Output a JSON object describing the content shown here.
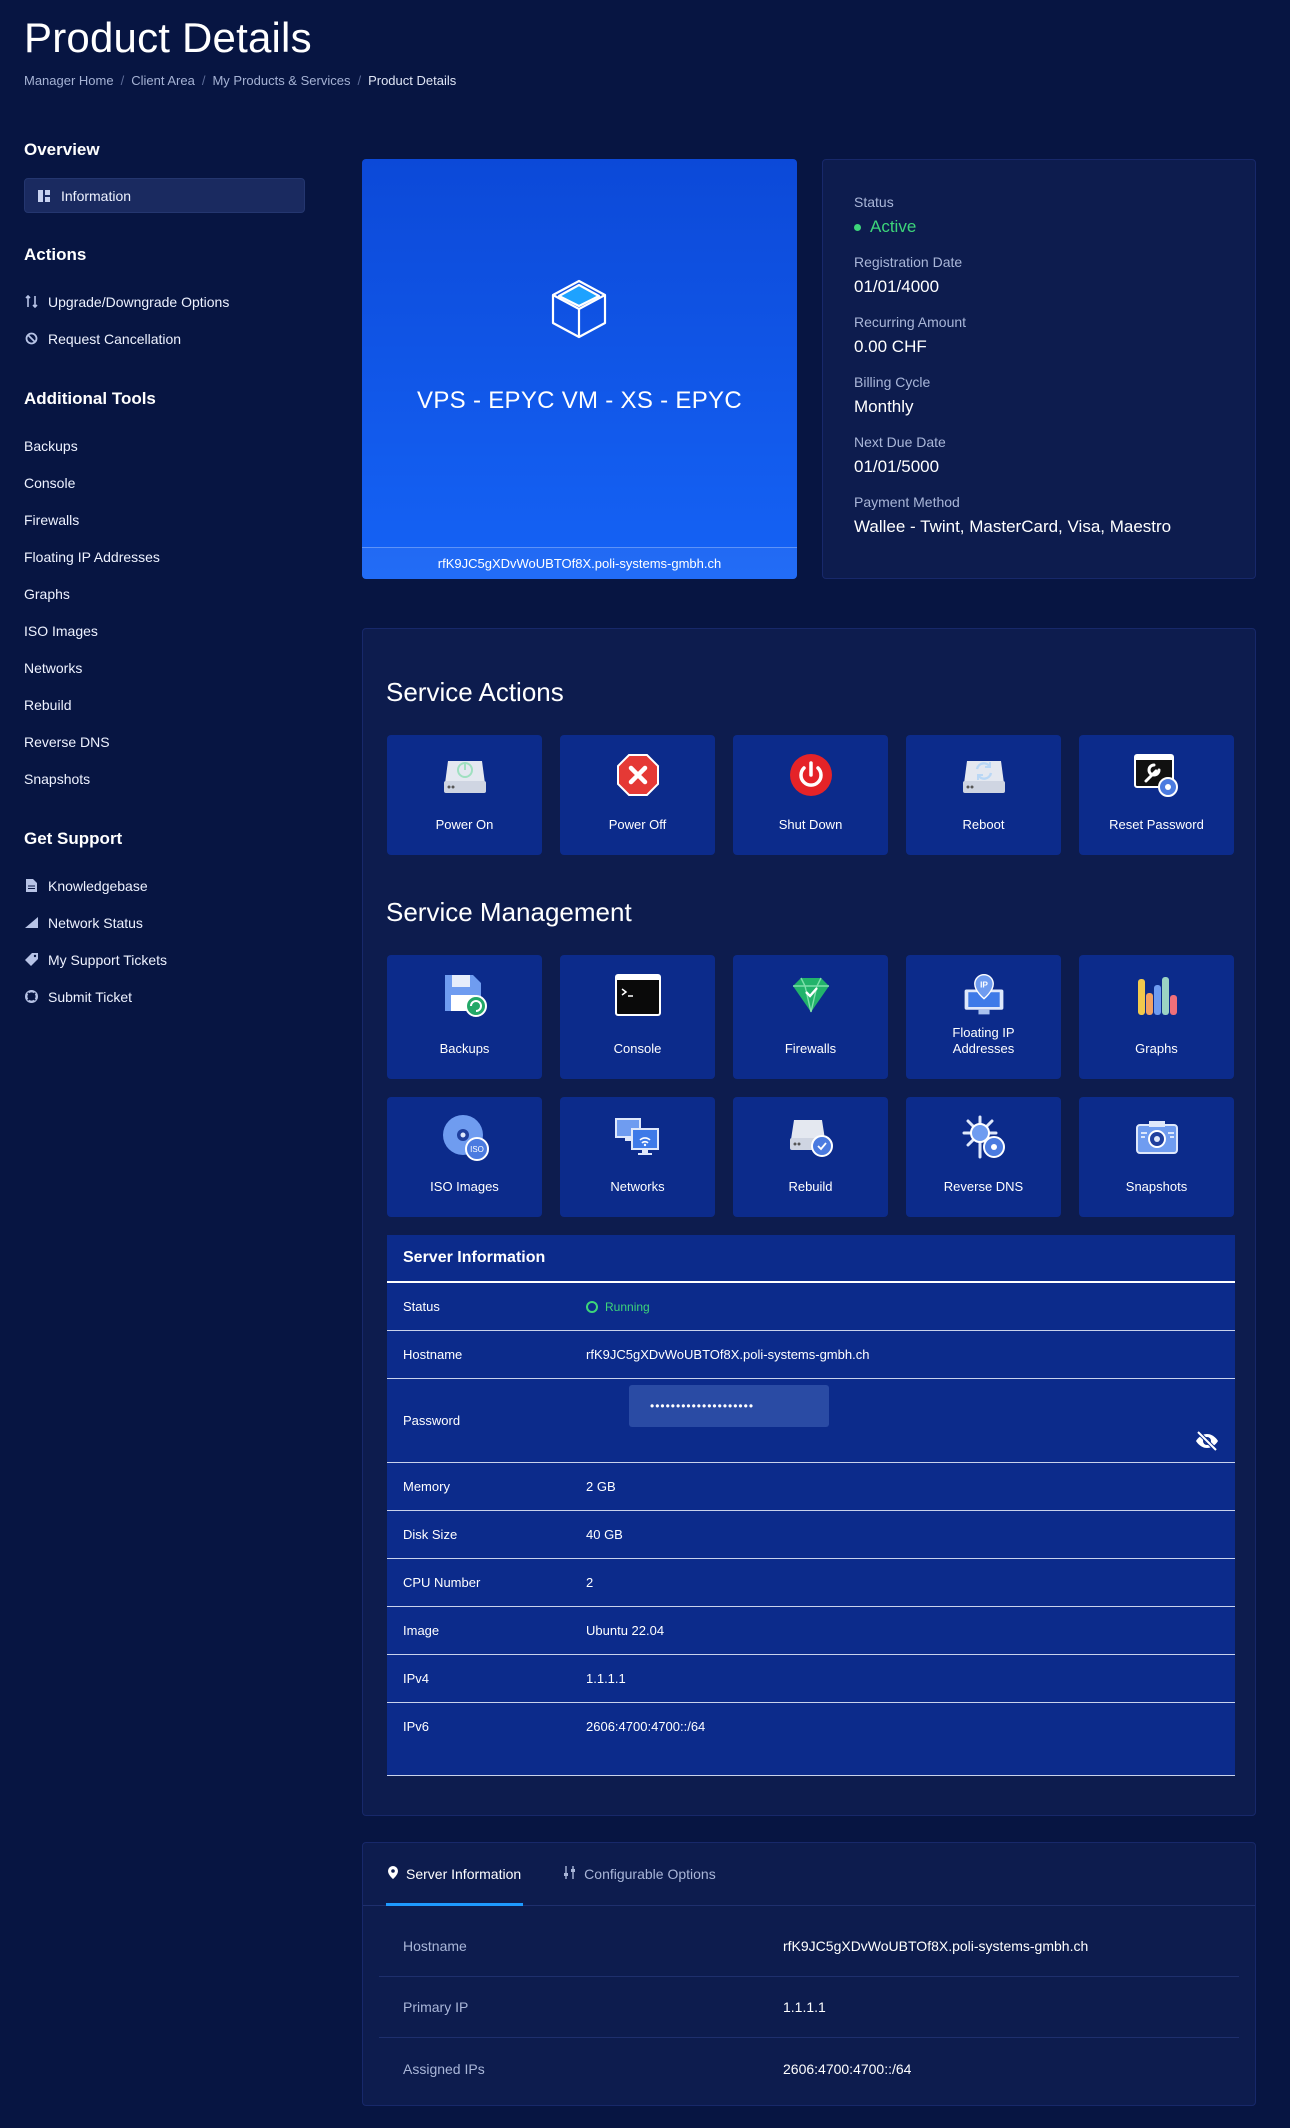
{
  "page": {
    "title": "Product Details"
  },
  "breadcrumb": [
    "Manager Home",
    "Client Area",
    "My Products & Services",
    "Product Details"
  ],
  "sidebar": {
    "overview": {
      "title": "Overview",
      "items": [
        {
          "label": "Information",
          "icon": "dashboard-icon"
        }
      ]
    },
    "actions": {
      "title": "Actions",
      "items": [
        {
          "label": "Upgrade/Downgrade Options",
          "icon": "sort-arrows-icon"
        },
        {
          "label": "Request Cancellation",
          "icon": "ban-icon"
        }
      ]
    },
    "tools": {
      "title": "Additional Tools",
      "items": [
        "Backups",
        "Console",
        "Firewalls",
        "Floating IP Addresses",
        "Graphs",
        "ISO Images",
        "Networks",
        "Rebuild",
        "Reverse DNS",
        "Snapshots"
      ]
    },
    "support": {
      "title": "Get Support",
      "items": [
        {
          "label": "Knowledgebase",
          "icon": "file-icon"
        },
        {
          "label": "Network Status",
          "icon": "signal-icon"
        },
        {
          "label": "My Support Tickets",
          "icon": "ticket-icon"
        },
        {
          "label": "Submit Ticket",
          "icon": "lifebuoy-icon"
        }
      ]
    }
  },
  "product": {
    "name": "VPS - EPYC VM - XS - EPYC",
    "domain": "rfK9JC5gXDvWoUBTOf8X.poli-systems-gmbh.ch"
  },
  "details": {
    "status_label": "Status",
    "status": "Active",
    "reg_label": "Registration Date",
    "reg": "01/01/4000",
    "amount_label": "Recurring Amount",
    "amount": "0.00 CHF",
    "cycle_label": "Billing Cycle",
    "cycle": "Monthly",
    "due_label": "Next Due Date",
    "due": "01/01/5000",
    "pay_label": "Payment Method",
    "pay": "Wallee - Twint, MasterCard, Visa, Maestro"
  },
  "service_actions": {
    "title": "Service Actions",
    "items": [
      "Power On",
      "Power Off",
      "Shut Down",
      "Reboot",
      "Reset Password"
    ]
  },
  "service_management": {
    "title": "Service Management",
    "items": [
      "Backups",
      "Console",
      "Firewalls",
      "Floating IP Addresses",
      "Graphs",
      "ISO Images",
      "Networks",
      "Rebuild",
      "Reverse DNS",
      "Snapshots"
    ]
  },
  "server_info": {
    "title": "Server Information",
    "status_label": "Status",
    "status": "Running",
    "hostname_label": "Hostname",
    "hostname": "rfK9JC5gXDvWoUBTOf8X.poli-systems-gmbh.ch",
    "password_label": "Password",
    "password": "••••••••••••••••••••",
    "memory_label": "Memory",
    "memory": "2 GB",
    "disk_label": "Disk Size",
    "disk": "40 GB",
    "cpu_label": "CPU Number",
    "cpu": "2",
    "image_label": "Image",
    "image": "Ubuntu 22.04",
    "ipv4_label": "IPv4",
    "ipv4": "1.1.1.1",
    "ipv6_label": "IPv6",
    "ipv6": "2606:4700:4700::/64"
  },
  "tabs": {
    "server": "Server Information",
    "config": "Configurable Options"
  },
  "tab_rows": [
    {
      "label": "Hostname",
      "value": "rfK9JC5gXDvWoUBTOf8X.poli-systems-gmbh.ch"
    },
    {
      "label": "Primary IP",
      "value": "1.1.1.1"
    },
    {
      "label": "Assigned IPs",
      "value": "2606:4700:4700::/64"
    }
  ],
  "colors": {
    "background": "#071542",
    "card": "#0d1c4e",
    "tile": "#0c2b8b",
    "accent": "#1563f6",
    "success": "#3dd57a"
  }
}
